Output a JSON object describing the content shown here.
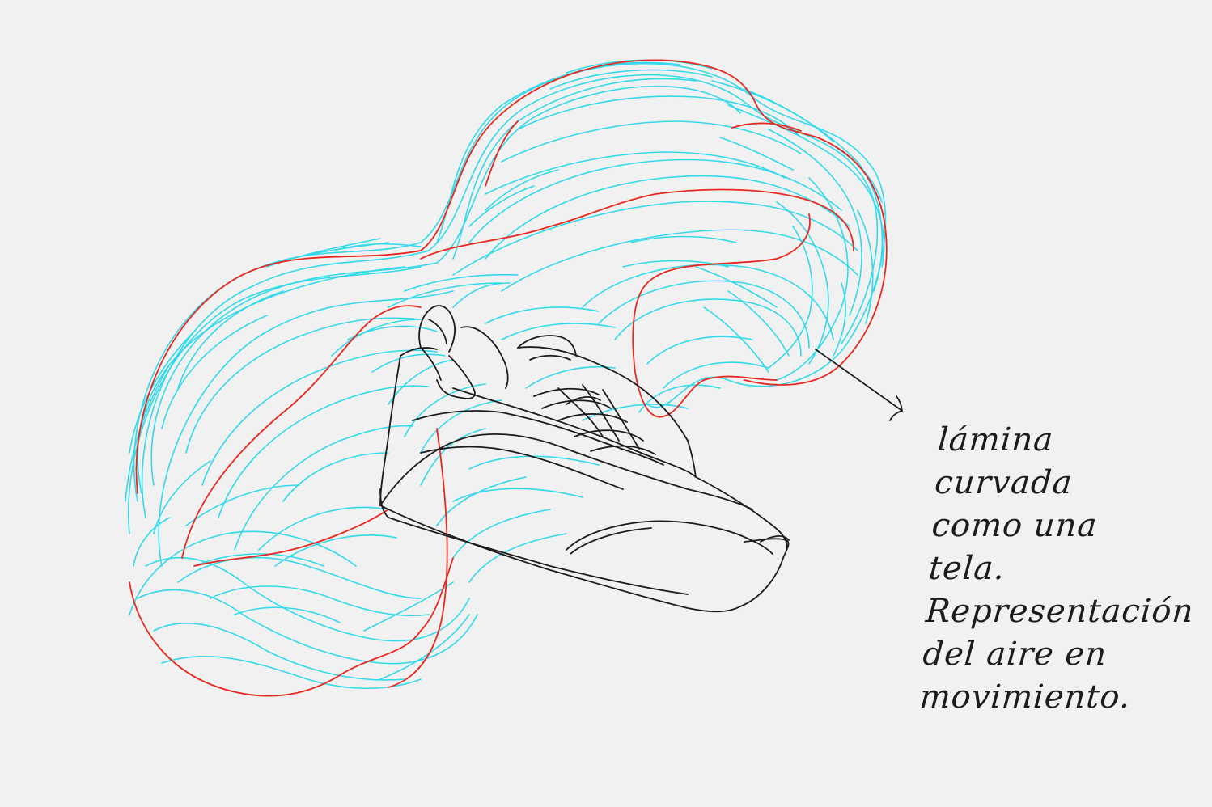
{
  "annotation": {
    "lines": [
      "lámina",
      "curvada",
      "como una",
      "tela.",
      "Representación",
      "del aire en",
      "movimiento."
    ]
  },
  "colors": {
    "background": "#f1f1f1",
    "air_strokes": "#29d8ea",
    "outline_strokes": "#e8281f",
    "shoe_ink": "#1c1c1c"
  }
}
